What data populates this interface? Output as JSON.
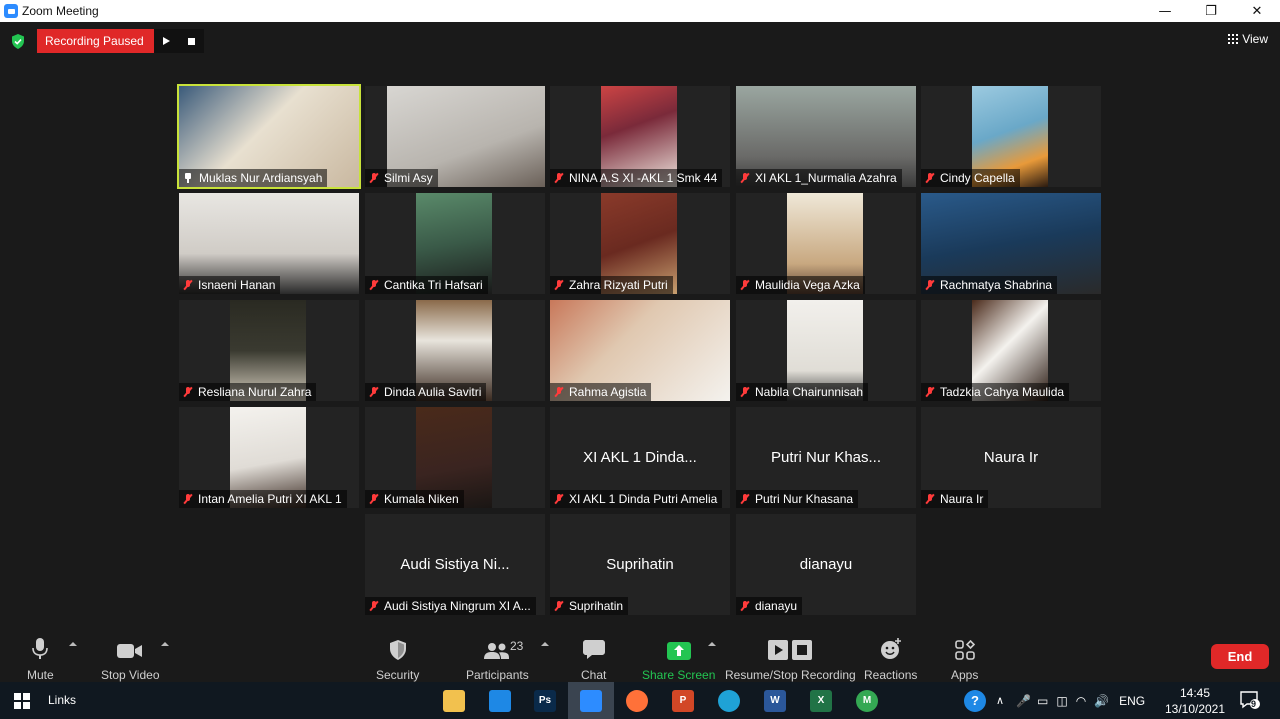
{
  "window": {
    "title": "Zoom Meeting",
    "minimize": "—",
    "restore": "❐",
    "close": "✕"
  },
  "topbar": {
    "recording_status": "Recording Paused",
    "view_label": "View"
  },
  "participants": [
    {
      "name": "Muklas Nur Ardiansyah",
      "video": true,
      "active": true,
      "pinned": true
    },
    {
      "name": "Silmi Asy",
      "video": true
    },
    {
      "name": "NINA A.S XI -AKL 1 Smk 44",
      "video": true
    },
    {
      "name": "XI AKL 1_Nurmalia Azahra",
      "video": true
    },
    {
      "name": "Cindy Capella",
      "video": true
    },
    {
      "name": "Isnaeni Hanan",
      "video": true
    },
    {
      "name": "Cantika Tri Hafsari",
      "video": true
    },
    {
      "name": "Zahra Rizyati Putri",
      "video": true
    },
    {
      "name": "Maulidia Vega Azka",
      "video": true
    },
    {
      "name": "Rachmatya Shabrina",
      "video": true
    },
    {
      "name": "Resliana Nurul Zahra",
      "video": true
    },
    {
      "name": "Dinda Aulia Savitri",
      "video": true
    },
    {
      "name": "Rahma Agistia",
      "video": true
    },
    {
      "name": "Nabila Chairunnisah",
      "video": true
    },
    {
      "name": "Tadzkia Cahya Maulida",
      "video": true
    },
    {
      "name": "Intan Amelia Putri XI AKL 1",
      "video": true
    },
    {
      "name": "Kumala Niken",
      "video": true
    },
    {
      "name": "XI AKL 1 Dinda Putri Amelia",
      "display": "XI AKL 1 Dinda...",
      "video": false
    },
    {
      "name": "Putri Nur Khasana",
      "display": "Putri Nur Khas...",
      "video": false
    },
    {
      "name": "Naura Ir",
      "display": "Naura Ir",
      "video": false
    },
    {
      "name": "Audi Sistiya Ningrum XI A...",
      "display": "Audi Sistiya Ni...",
      "video": false
    },
    {
      "name": "Suprihatin",
      "display": "Suprihatin",
      "video": false
    },
    {
      "name": "dianayu",
      "display": "dianayu",
      "video": false
    }
  ],
  "toolbar": {
    "mute": "Mute",
    "stop_video": "Stop Video",
    "security": "Security",
    "participants": "Participants",
    "participants_count": "23",
    "chat": "Chat",
    "share_screen": "Share Screen",
    "recording": "Resume/Stop Recording",
    "reactions": "Reactions",
    "apps": "Apps",
    "end": "End"
  },
  "taskbar": {
    "links": "Links",
    "apps": [
      {
        "icon": "file-explorer-icon",
        "label": "",
        "color": "#f2c14e"
      },
      {
        "icon": "vscode-icon",
        "label": "",
        "color": "#1e88e5"
      },
      {
        "icon": "photoshop-icon",
        "label": "Ps",
        "color": "#0a2a4a"
      },
      {
        "icon": "zoom-icon",
        "label": "",
        "color": "#2d8cff"
      },
      {
        "icon": "firefox-icon",
        "label": "",
        "color": "#ff7139"
      },
      {
        "icon": "powerpoint-icon",
        "label": "P",
        "color": "#d24726"
      },
      {
        "icon": "edge-icon",
        "label": "",
        "color": "#1fa2d6"
      },
      {
        "icon": "word-icon",
        "label": "W",
        "color": "#2b579a"
      },
      {
        "icon": "excel-icon",
        "label": "X",
        "color": "#217346"
      },
      {
        "icon": "chrome-icon",
        "label": "M",
        "color": "#34a853"
      }
    ],
    "language": "ENG",
    "time": "14:45",
    "date": "13/10/2021",
    "notification_count": "9"
  },
  "colors": {
    "active_speaker": "#c8e23a",
    "recording": "#e02828",
    "share_green": "#23c552",
    "end_button": "#e02828"
  }
}
